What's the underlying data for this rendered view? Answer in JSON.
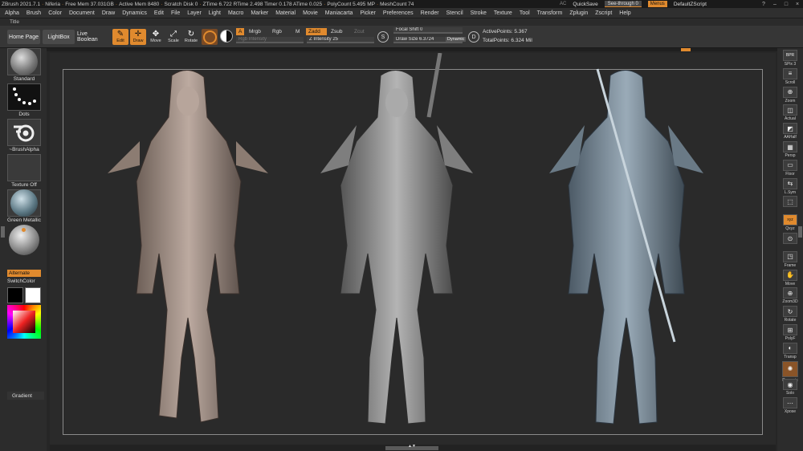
{
  "titlebar": {
    "app": "ZBrush 2021.7.1",
    "file": "Niferia",
    "stats": [
      "Free Mem 37.031GB",
      "Active Mem 8480",
      "Scratch Disk 0",
      "ZTime 6.722 RTime 2.498 Timer 0.178 ATime 0.025",
      "PolyCount 5.495 MP",
      "MeshCount 74"
    ],
    "ac": "AC",
    "quicksave": "QuickSave",
    "seethrough": "See-through  0",
    "menus": "Menus",
    "script": "DefaultZScript",
    "controls": [
      "?",
      "–",
      "□",
      "×"
    ]
  },
  "menubar": [
    "Alpha",
    "Brush",
    "Color",
    "Document",
    "Draw",
    "Dynamics",
    "Edit",
    "File",
    "Layer",
    "Light",
    "Macro",
    "Marker",
    "Material",
    "Movie",
    "Maniacarta",
    "Picker",
    "Preferences",
    "Render",
    "Stencil",
    "Stroke",
    "Texture",
    "Tool",
    "Transform",
    "Zplugin",
    "Zscript",
    "Help"
  ],
  "title_row": "Title",
  "toolbar": {
    "home": "Home Page",
    "lightbox": "LightBox",
    "liveboolean": "Live Boolean",
    "modes": [
      {
        "glyph": "✎",
        "label": "Edit",
        "active": true
      },
      {
        "glyph": "✛",
        "label": "Draw",
        "active": true
      },
      {
        "glyph": "✥",
        "label": "Move",
        "active": false
      },
      {
        "glyph": "⤢",
        "label": "Scale",
        "active": false
      },
      {
        "glyph": "↻",
        "label": "Rotate",
        "active": false
      }
    ],
    "a_btn": "A",
    "mrgb": "Mrgb",
    "rgb": "Rgb",
    "m": "M",
    "zadd": "Zadd",
    "zsub": "Zsub",
    "zcut": "Zcut",
    "rgb_intensity": "Rgb Intensity",
    "z_intensity": "Z Intensity 25",
    "z_intensity_level": 0.25,
    "focal_shift": "Focal Shift 0",
    "draw_size": "Draw Size 6.3724",
    "dynamic": "Dynamic",
    "s_label": "S",
    "d_label": "D",
    "active_points": "ActivePoints: 5.367",
    "total_points": "TotalPoints: 6.324 Mil"
  },
  "left_shelf": {
    "brush": "Standard",
    "stroke": "Dots",
    "alpha": "~BrushAlpha",
    "texture": "Texture Off",
    "material": "Green Metallic",
    "alternate": "Alternate",
    "switchcolor": "SwitchColor",
    "gradient": "Gradient"
  },
  "right_shelf": [
    {
      "icon": "BPR",
      "label": "SPix 3"
    },
    {
      "icon": "≡",
      "label": "Scroll"
    },
    {
      "icon": "⊕",
      "label": "Zoom"
    },
    {
      "icon": "◫",
      "label": "Actual"
    },
    {
      "icon": "◩",
      "label": "AAHalf"
    },
    {
      "icon": "▦",
      "label": "Persp"
    },
    {
      "icon": "▭",
      "label": "Floor"
    },
    {
      "icon": "⇆",
      "label": "L.Sym"
    },
    {
      "icon": "⬚",
      "label": ""
    },
    {
      "icon": "xyz",
      "label": "Qxyz",
      "active": true
    },
    {
      "icon": "⊙",
      "label": ""
    },
    {
      "icon": "◳",
      "label": "Frame"
    },
    {
      "icon": "✋",
      "label": "Move"
    },
    {
      "icon": "⊕",
      "label": "Zoom3D"
    },
    {
      "icon": "↻",
      "label": "Rotate"
    },
    {
      "icon": "⊞",
      "label": "PolyF"
    },
    {
      "icon": "◐",
      "label": "Transp"
    },
    {
      "icon": "✺",
      "label": "Dynamic",
      "brown": true
    },
    {
      "icon": "◉",
      "label": "Solo"
    },
    {
      "icon": "⋯",
      "label": "Xpose"
    }
  ]
}
